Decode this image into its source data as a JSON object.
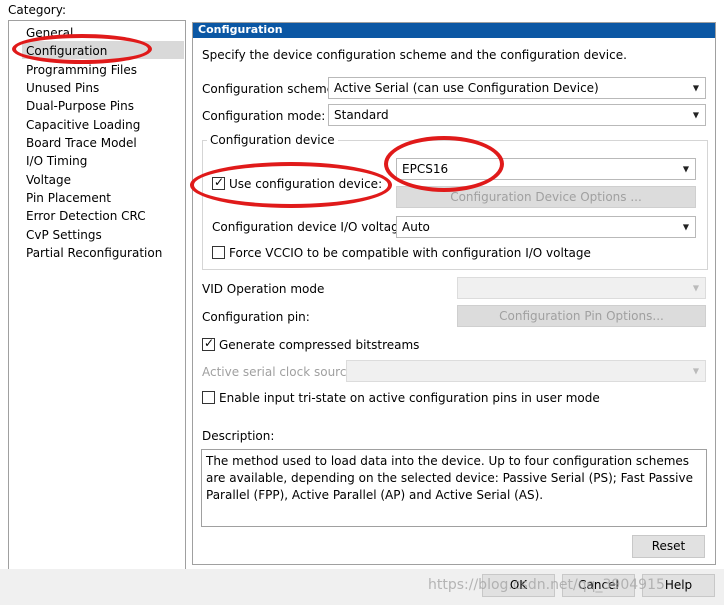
{
  "category_label": "Category:",
  "categories": [
    {
      "label": "General"
    },
    {
      "label": "Configuration"
    },
    {
      "label": "Programming Files"
    },
    {
      "label": "Unused Pins"
    },
    {
      "label": "Dual-Purpose Pins"
    },
    {
      "label": "Capacitive Loading"
    },
    {
      "label": "Board Trace Model"
    },
    {
      "label": "I/O Timing"
    },
    {
      "label": "Voltage"
    },
    {
      "label": "Pin Placement"
    },
    {
      "label": "Error Detection CRC"
    },
    {
      "label": "CvP Settings"
    },
    {
      "label": "Partial Reconfiguration"
    }
  ],
  "panel": {
    "title": "Configuration",
    "intro": "Specify the device configuration scheme and the configuration device.",
    "scheme_label": "Configuration scheme:",
    "scheme_value": "Active Serial (can use Configuration Device)",
    "mode_label": "Configuration mode:",
    "mode_value": "Standard",
    "device_group_title": "Configuration device",
    "use_device_label": "Use configuration device:",
    "device_value": "EPCS16",
    "device_options_button": "Configuration Device Options ...",
    "io_voltage_label": "Configuration device I/O voltage:",
    "io_voltage_value": "Auto",
    "force_vccio_label": "Force VCCIO to be compatible with configuration I/O voltage",
    "vid_label": "VID Operation mode",
    "pin_label": "Configuration pin:",
    "pin_options_button": "Configuration Pin Options...",
    "compressed_label": "Generate compressed bitstreams",
    "clock_source_label": "Active serial clock source:",
    "tristate_label": "Enable input tri-state on active configuration pins in user mode",
    "description_label": "Description:",
    "description_text": "The method used to load data into the device. Up to four configuration schemes are available, depending on the selected device: Passive Serial (PS); Fast Passive Parallel (FPP), Active Parallel (AP) and Active Serial (AS).",
    "reset_button": "Reset"
  },
  "footer": {
    "watermark": "https://blog.csdn.net/qq_3904915",
    "ok_button": "OK",
    "cancel_button": "Cancel",
    "help_button": "Help"
  },
  "checkbox_states": {
    "use_device": true,
    "force_vccio": false,
    "compressed": true,
    "tristate": false
  },
  "colors": {
    "panel_title_bg": "#0b57a4",
    "selection_bg": "#d9d9d9",
    "annotation_red": "#e01a1a"
  },
  "icons": [
    "dropdown-arrow-icon",
    "checkmark-icon"
  ]
}
